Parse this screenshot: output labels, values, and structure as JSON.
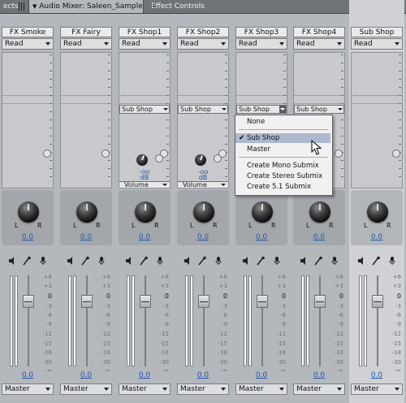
{
  "tabs": [
    {
      "label": "ects",
      "active": false
    },
    {
      "label": "Audio Mixer: Saleen_Sample",
      "active": true,
      "close": "×"
    },
    {
      "label": "Effect Controls",
      "active": false
    }
  ],
  "tracks": [
    {
      "name": "FX Smoke",
      "automation": "Read",
      "send": "",
      "send_level": "",
      "send_unit": "",
      "send_param": "",
      "pan": "0.0",
      "pan_left": "L",
      "pan_right": "R",
      "fader": "0.0",
      "output": "Master"
    },
    {
      "name": "FX Fairy",
      "automation": "Read",
      "send": "",
      "send_level": "",
      "send_unit": "",
      "send_param": "",
      "pan": "0.0",
      "pan_left": "L",
      "pan_right": "R",
      "fader": "0.0",
      "output": "Master"
    },
    {
      "name": "FX Shop1",
      "automation": "Read",
      "send": "Sub Shop",
      "send_level": "-oo",
      "send_unit": "dB",
      "send_param": "Volume",
      "pan": "0.0",
      "pan_left": "L",
      "pan_right": "R",
      "fader": "0.0",
      "output": "Master"
    },
    {
      "name": "FX Shop2",
      "automation": "Read",
      "send": "Sub Shop",
      "send_level": "-oo",
      "send_unit": "dB",
      "send_param": "Volume",
      "pan": "0.0",
      "pan_left": "L",
      "pan_right": "R",
      "fader": "0.0",
      "output": "Master"
    },
    {
      "name": "FX Shop3",
      "automation": "Read",
      "send": "Sub Shop",
      "send_level": "",
      "send_unit": "",
      "send_param": "",
      "pan": "0.0",
      "pan_left": "L",
      "pan_right": "R",
      "fader": "0.0",
      "output": "Master"
    },
    {
      "name": "FX Shop4",
      "automation": "Read",
      "send": "Sub Shop",
      "send_level": "",
      "send_unit": "",
      "send_param": "",
      "pan": "0.0",
      "pan_left": "L",
      "pan_right": "R",
      "fader": "0.0",
      "output": "Master"
    },
    {
      "name": "Sub Shop",
      "automation": "Read",
      "send": "",
      "send_level": "",
      "send_unit": "",
      "send_param": "",
      "pan": "0.0",
      "pan_left": "L",
      "pan_right": "R",
      "fader": "0.0",
      "output": "Master"
    }
  ],
  "fader_scale": [
    "+6",
    "+3",
    "0",
    "-3",
    "-6",
    "-9",
    "-12",
    "-15",
    "-18",
    "-30",
    "-∞"
  ],
  "send_menu": {
    "items": [
      "None",
      "Sub Shop",
      "Master",
      "Create Mono Submix",
      "Create Stereo Submix",
      "Create 5.1 Submix"
    ],
    "checked": "Sub Shop"
  },
  "colors": {
    "value_blue": "#2456a8",
    "menu_highlight": "#aeb9cf"
  },
  "icons": [
    "mute-icon",
    "solo-icon",
    "record-icon",
    "speaker-icon"
  ]
}
